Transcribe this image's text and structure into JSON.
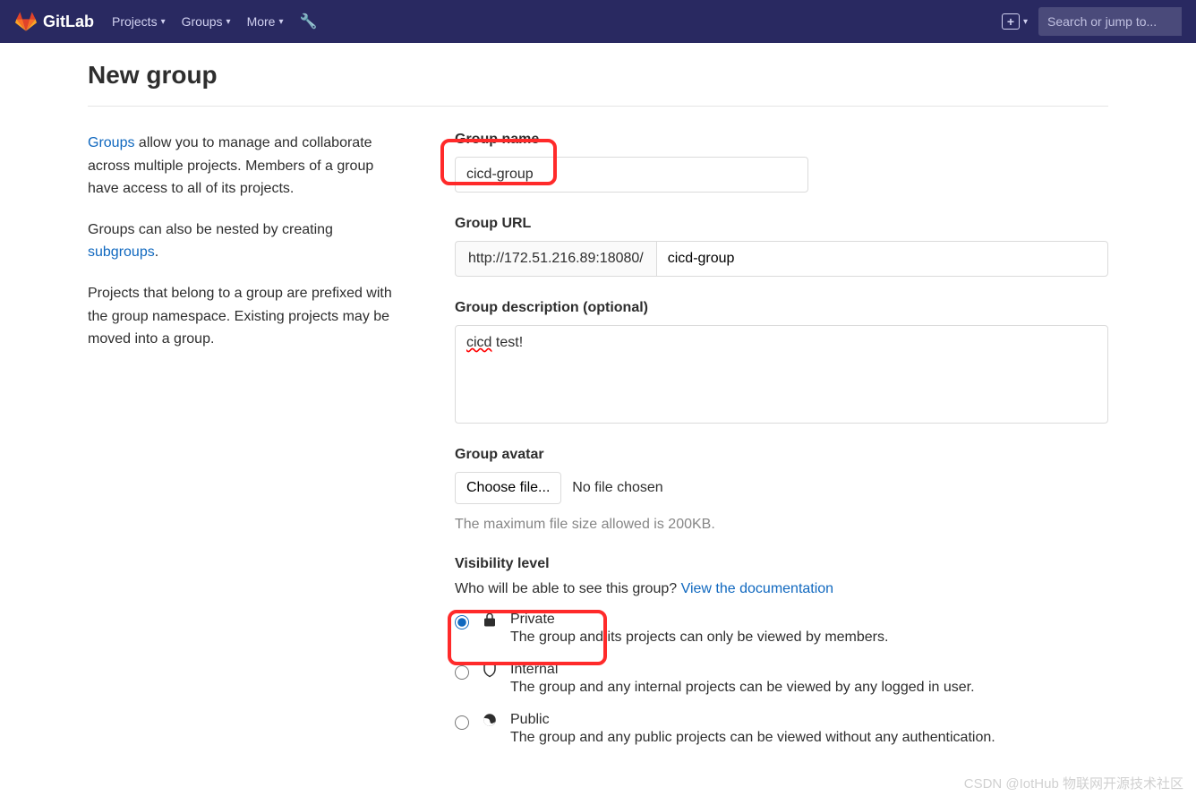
{
  "nav": {
    "brand": "GitLab",
    "items": [
      "Projects",
      "Groups",
      "More"
    ],
    "searchPlaceholder": "Search or jump to..."
  },
  "page": {
    "title": "New group"
  },
  "left": {
    "p1a": "Groups",
    "p1b": " allow you to manage and collaborate across multiple projects. Members of a group have access to all of its projects.",
    "p2a": "Groups can also be nested by creating ",
    "p2b": "subgroups",
    "p2c": ".",
    "p3": "Projects that belong to a group are prefixed with the group namespace. Existing projects may be moved into a group."
  },
  "form": {
    "groupName": {
      "label": "Group name",
      "value": "cicd-group"
    },
    "groupUrl": {
      "label": "Group URL",
      "prefix": "http://172.51.216.89:18080/",
      "value": "cicd-group"
    },
    "desc": {
      "label": "Group description (optional)",
      "w1": "cicd",
      "w2": " test!"
    },
    "avatar": {
      "label": "Group avatar",
      "button": "Choose file...",
      "status": "No file chosen",
      "hint": "The maximum file size allowed is 200KB."
    },
    "visibility": {
      "label": "Visibility level",
      "helpA": "Who will be able to see this group? ",
      "helpLink": "View the documentation",
      "private": {
        "title": "Private",
        "desc": "The group and its projects can only be viewed by members."
      },
      "internal": {
        "title": "Internal",
        "desc": "The group and any internal projects can be viewed by any logged in user."
      },
      "public": {
        "title": "Public",
        "desc": "The group and any public projects can be viewed without any authentication."
      }
    }
  },
  "watermark": "CSDN @IotHub  物联网开源技术社区"
}
